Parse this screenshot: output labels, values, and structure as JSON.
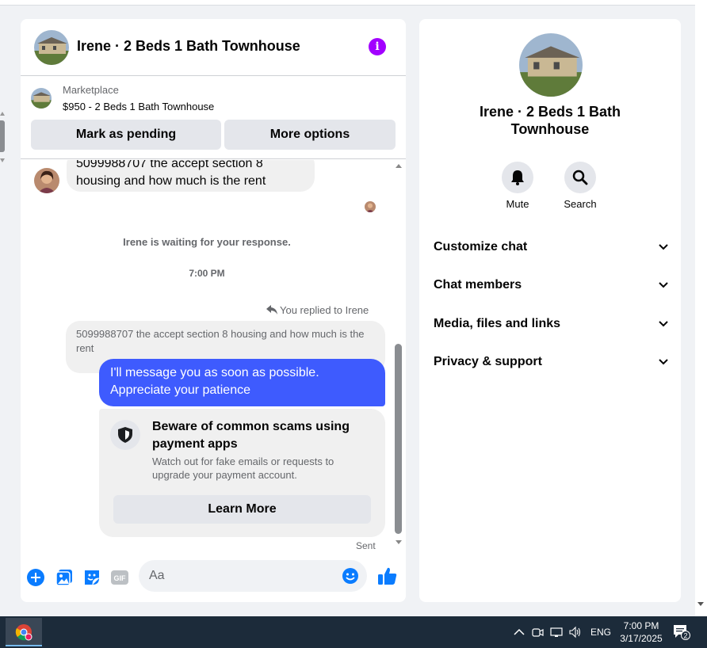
{
  "chat": {
    "title": "Irene · 2 Beds 1 Bath Townhouse",
    "info_icon": "info-icon",
    "marketplace": {
      "label": "Marketplace",
      "listing": "$950 - 2 Beds 1 Bath Townhouse",
      "btn_pending": "Mark as pending",
      "btn_more": "More options"
    },
    "messages": {
      "incoming_text": "5099988707 the accept section 8 housing and how much is the rent",
      "waiting_text": "Irene is waiting for your response.",
      "time_separator": "7:00 PM",
      "replied_text": "You replied to Irene",
      "quoted_text": "5099988707 the accept section 8 housing and how much is the rent",
      "outgoing_text": "I'll message you as soon as possible. Appreciate your patience",
      "scam_title": "Beware of common scams using payment apps",
      "scam_desc": "Watch out for fake emails or requests to upgrade your payment account.",
      "learn_more": "Learn More",
      "status": "Sent"
    },
    "composer": {
      "placeholder": "Aa",
      "value": ""
    }
  },
  "side": {
    "title": "Irene · 2 Beds 1 Bath Townhouse",
    "actions": [
      {
        "label": "Mute",
        "icon": "bell-icon"
      },
      {
        "label": "Search",
        "icon": "search-icon"
      }
    ],
    "sections": [
      "Customize chat",
      "Chat members",
      "Media, files and links",
      "Privacy & support"
    ]
  },
  "taskbar": {
    "lang": "ENG",
    "time": "7:00 PM",
    "date": "3/17/2025",
    "notification_count": "2"
  },
  "colors": {
    "accent_purple": "#a200ff",
    "outgoing_blue": "#3e5bfe",
    "messenger_blue": "#0a7cff",
    "taskbar": "#1c2b3a"
  }
}
